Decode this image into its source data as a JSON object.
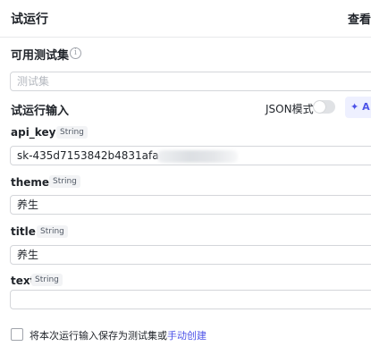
{
  "header": {
    "title": "试运行",
    "view_label": "查看"
  },
  "test_sets": {
    "label": "可用测试集",
    "placeholder": "测试集"
  },
  "run_input": {
    "label": "试运行输入",
    "json_mode_label": "JSON模式",
    "ai_button_label": "A"
  },
  "fields": [
    {
      "name": "api_key",
      "required": true,
      "type": "String",
      "value": "sk-435d7153842b4831afa"
    },
    {
      "name": "theme",
      "required": true,
      "type": "String",
      "value": "养生"
    },
    {
      "name": "title",
      "required": true,
      "type": "String",
      "value": "养生"
    },
    {
      "name": "text",
      "required": false,
      "type": "String",
      "value": ""
    }
  ],
  "footer": {
    "save_text": "将本次运行输入保存为测试集或",
    "manual_create_link": "手动创建"
  },
  "icons": {
    "info": "info-icon",
    "sparkle": "sparkle-icon",
    "checkbox": "checkbox-icon"
  },
  "colors": {
    "accent": "#4d53e8",
    "required": "#f54a45",
    "border": "#d4d6da"
  }
}
